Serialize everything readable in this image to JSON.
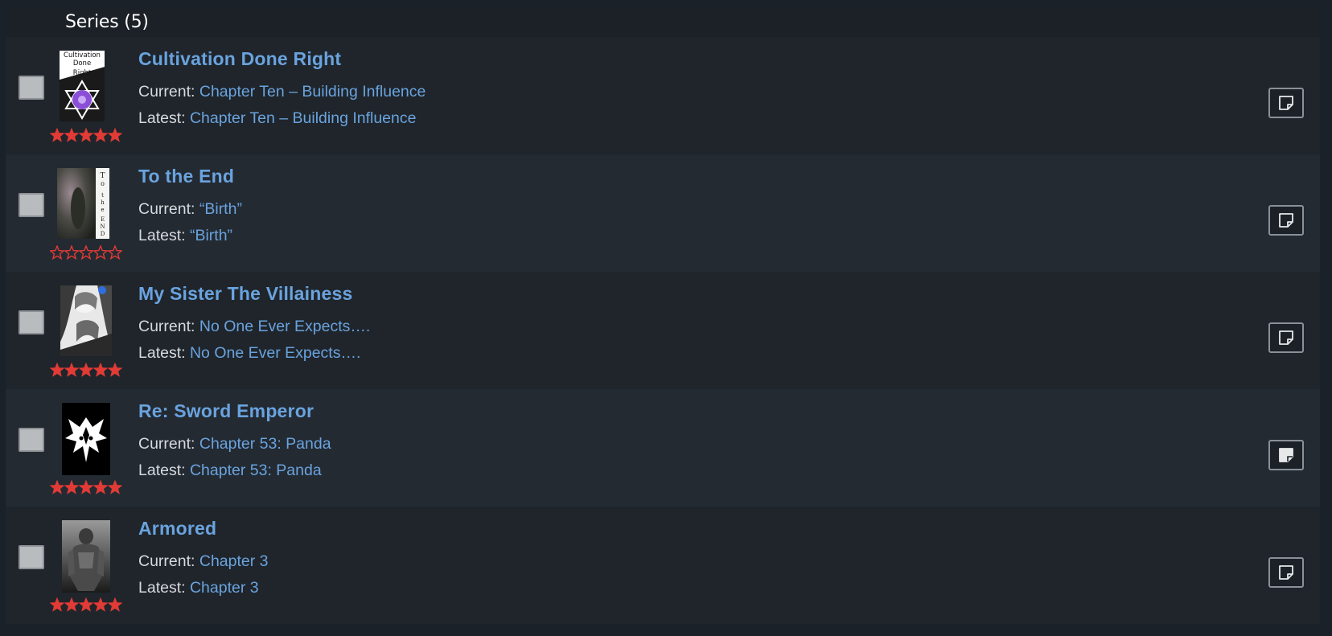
{
  "header": {
    "title": "Series (5)"
  },
  "colors": {
    "link": "#6aa3de",
    "star": "#e23b36",
    "background": "#1b2128"
  },
  "series": [
    {
      "title": "Cultivation Done Right",
      "current_label": "Current: ",
      "current": "Chapter Ten – Building Influence",
      "latest_label": "Latest: ",
      "latest": "Chapter Ten – Building Influence",
      "rating": 5,
      "cover_text": [
        "Cultivation",
        "Done",
        "Right"
      ],
      "note_filled": false
    },
    {
      "title": "To the End",
      "current_label": "Current: ",
      "current": "“Birth”",
      "latest_label": "Latest: ",
      "latest": "“Birth”",
      "rating": 0,
      "cover_text": [
        "T",
        "o",
        "t",
        "h",
        "e",
        "E",
        "N",
        "D"
      ],
      "note_filled": false
    },
    {
      "title": "My Sister The Villainess",
      "current_label": "Current: ",
      "current": "No One Ever Expects….",
      "latest_label": "Latest: ",
      "latest": "No One Ever Expects….",
      "rating": 5,
      "note_filled": false
    },
    {
      "title": "Re: Sword Emperor",
      "current_label": "Current: ",
      "current": "Chapter 53: Panda",
      "latest_label": "Latest: ",
      "latest": "Chapter 53: Panda",
      "rating": 5,
      "note_filled": true
    },
    {
      "title": "Armored",
      "current_label": "Current: ",
      "current": "Chapter 3",
      "latest_label": "Latest: ",
      "latest": "Chapter 3",
      "rating": 5,
      "note_filled": false
    }
  ]
}
